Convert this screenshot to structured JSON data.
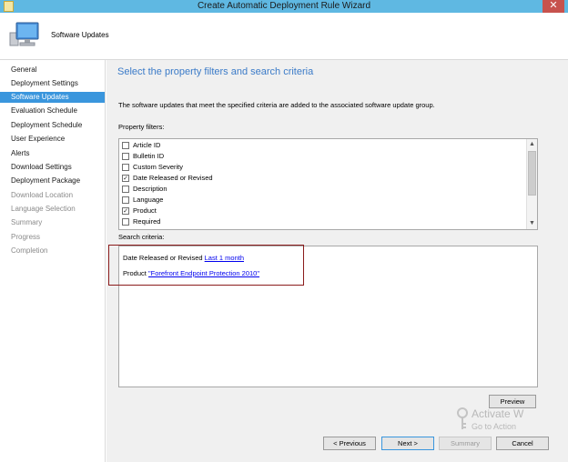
{
  "window": {
    "title": "Create Automatic Deployment Rule Wizard",
    "close_glyph": "✕"
  },
  "header": {
    "banner_title": "Software Updates",
    "banner_icon": "computer-monitor-icon"
  },
  "nav": {
    "items": [
      {
        "label": "General",
        "state": "normal"
      },
      {
        "label": "Deployment Settings",
        "state": "normal"
      },
      {
        "label": "Software Updates",
        "state": "active"
      },
      {
        "label": "Evaluation Schedule",
        "state": "normal"
      },
      {
        "label": "Deployment Schedule",
        "state": "normal"
      },
      {
        "label": "User Experience",
        "state": "normal"
      },
      {
        "label": "Alerts",
        "state": "normal"
      },
      {
        "label": "Download Settings",
        "state": "normal"
      },
      {
        "label": "Deployment Package",
        "state": "normal"
      },
      {
        "label": "Download Location",
        "state": "disabled"
      },
      {
        "label": "Language Selection",
        "state": "disabled"
      },
      {
        "label": "Summary",
        "state": "disabled"
      },
      {
        "label": "Progress",
        "state": "disabled"
      },
      {
        "label": "Completion",
        "state": "disabled"
      }
    ]
  },
  "main": {
    "page_title": "Select the property filters and search criteria",
    "description": "The software updates that meet the specified criteria are added to the associated software update group.",
    "filters_label": "Property filters:",
    "filters": [
      {
        "label": "Article ID",
        "checked": false
      },
      {
        "label": "Bulletin ID",
        "checked": false
      },
      {
        "label": "Custom Severity",
        "checked": false
      },
      {
        "label": "Date Released or Revised",
        "checked": true
      },
      {
        "label": "Description",
        "checked": false
      },
      {
        "label": "Language",
        "checked": false
      },
      {
        "label": "Product",
        "checked": true
      },
      {
        "label": "Required",
        "checked": false
      }
    ],
    "criteria_label": "Search criteria:",
    "criteria": [
      {
        "label": "Date Released or Revised",
        "value": "Last 1 month"
      },
      {
        "label": "Product",
        "value": "\"Forefront Endpoint Protection 2010\""
      }
    ],
    "highlight_color": "#8b1b1b"
  },
  "buttons": {
    "preview": "Preview",
    "previous": "< Previous",
    "next": "Next >",
    "summary": "Summary",
    "cancel": "Cancel"
  },
  "watermark": {
    "title": "Activate W",
    "subtitle": "Go to Action"
  },
  "colors": {
    "accent": "#3a96dd",
    "title_blue": "#3b7bc8",
    "titlebar": "#5fb8e2",
    "close": "#c7524d"
  }
}
